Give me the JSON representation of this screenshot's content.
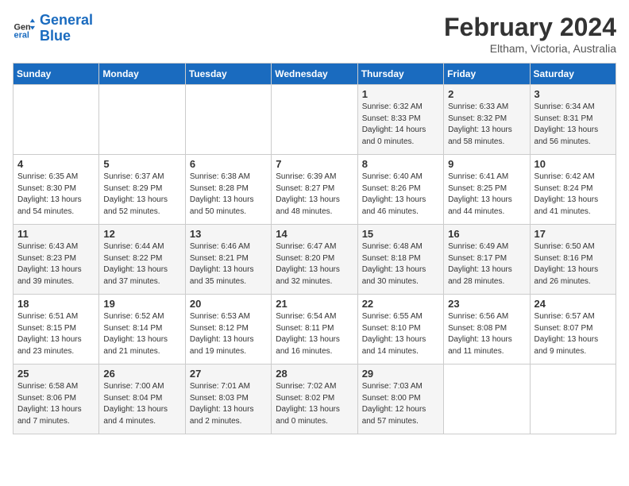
{
  "logo": {
    "line1": "General",
    "line2": "Blue"
  },
  "title": "February 2024",
  "location": "Eltham, Victoria, Australia",
  "headers": [
    "Sunday",
    "Monday",
    "Tuesday",
    "Wednesday",
    "Thursday",
    "Friday",
    "Saturday"
  ],
  "weeks": [
    [
      {
        "day": "",
        "sunrise": "",
        "sunset": "",
        "daylight": ""
      },
      {
        "day": "",
        "sunrise": "",
        "sunset": "",
        "daylight": ""
      },
      {
        "day": "",
        "sunrise": "",
        "sunset": "",
        "daylight": ""
      },
      {
        "day": "",
        "sunrise": "",
        "sunset": "",
        "daylight": ""
      },
      {
        "day": "1",
        "sunrise": "Sunrise: 6:32 AM",
        "sunset": "Sunset: 8:33 PM",
        "daylight": "Daylight: 14 hours and 0 minutes."
      },
      {
        "day": "2",
        "sunrise": "Sunrise: 6:33 AM",
        "sunset": "Sunset: 8:32 PM",
        "daylight": "Daylight: 13 hours and 58 minutes."
      },
      {
        "day": "3",
        "sunrise": "Sunrise: 6:34 AM",
        "sunset": "Sunset: 8:31 PM",
        "daylight": "Daylight: 13 hours and 56 minutes."
      }
    ],
    [
      {
        "day": "4",
        "sunrise": "Sunrise: 6:35 AM",
        "sunset": "Sunset: 8:30 PM",
        "daylight": "Daylight: 13 hours and 54 minutes."
      },
      {
        "day": "5",
        "sunrise": "Sunrise: 6:37 AM",
        "sunset": "Sunset: 8:29 PM",
        "daylight": "Daylight: 13 hours and 52 minutes."
      },
      {
        "day": "6",
        "sunrise": "Sunrise: 6:38 AM",
        "sunset": "Sunset: 8:28 PM",
        "daylight": "Daylight: 13 hours and 50 minutes."
      },
      {
        "day": "7",
        "sunrise": "Sunrise: 6:39 AM",
        "sunset": "Sunset: 8:27 PM",
        "daylight": "Daylight: 13 hours and 48 minutes."
      },
      {
        "day": "8",
        "sunrise": "Sunrise: 6:40 AM",
        "sunset": "Sunset: 8:26 PM",
        "daylight": "Daylight: 13 hours and 46 minutes."
      },
      {
        "day": "9",
        "sunrise": "Sunrise: 6:41 AM",
        "sunset": "Sunset: 8:25 PM",
        "daylight": "Daylight: 13 hours and 44 minutes."
      },
      {
        "day": "10",
        "sunrise": "Sunrise: 6:42 AM",
        "sunset": "Sunset: 8:24 PM",
        "daylight": "Daylight: 13 hours and 41 minutes."
      }
    ],
    [
      {
        "day": "11",
        "sunrise": "Sunrise: 6:43 AM",
        "sunset": "Sunset: 8:23 PM",
        "daylight": "Daylight: 13 hours and 39 minutes."
      },
      {
        "day": "12",
        "sunrise": "Sunrise: 6:44 AM",
        "sunset": "Sunset: 8:22 PM",
        "daylight": "Daylight: 13 hours and 37 minutes."
      },
      {
        "day": "13",
        "sunrise": "Sunrise: 6:46 AM",
        "sunset": "Sunset: 8:21 PM",
        "daylight": "Daylight: 13 hours and 35 minutes."
      },
      {
        "day": "14",
        "sunrise": "Sunrise: 6:47 AM",
        "sunset": "Sunset: 8:20 PM",
        "daylight": "Daylight: 13 hours and 32 minutes."
      },
      {
        "day": "15",
        "sunrise": "Sunrise: 6:48 AM",
        "sunset": "Sunset: 8:18 PM",
        "daylight": "Daylight: 13 hours and 30 minutes."
      },
      {
        "day": "16",
        "sunrise": "Sunrise: 6:49 AM",
        "sunset": "Sunset: 8:17 PM",
        "daylight": "Daylight: 13 hours and 28 minutes."
      },
      {
        "day": "17",
        "sunrise": "Sunrise: 6:50 AM",
        "sunset": "Sunset: 8:16 PM",
        "daylight": "Daylight: 13 hours and 26 minutes."
      }
    ],
    [
      {
        "day": "18",
        "sunrise": "Sunrise: 6:51 AM",
        "sunset": "Sunset: 8:15 PM",
        "daylight": "Daylight: 13 hours and 23 minutes."
      },
      {
        "day": "19",
        "sunrise": "Sunrise: 6:52 AM",
        "sunset": "Sunset: 8:14 PM",
        "daylight": "Daylight: 13 hours and 21 minutes."
      },
      {
        "day": "20",
        "sunrise": "Sunrise: 6:53 AM",
        "sunset": "Sunset: 8:12 PM",
        "daylight": "Daylight: 13 hours and 19 minutes."
      },
      {
        "day": "21",
        "sunrise": "Sunrise: 6:54 AM",
        "sunset": "Sunset: 8:11 PM",
        "daylight": "Daylight: 13 hours and 16 minutes."
      },
      {
        "day": "22",
        "sunrise": "Sunrise: 6:55 AM",
        "sunset": "Sunset: 8:10 PM",
        "daylight": "Daylight: 13 hours and 14 minutes."
      },
      {
        "day": "23",
        "sunrise": "Sunrise: 6:56 AM",
        "sunset": "Sunset: 8:08 PM",
        "daylight": "Daylight: 13 hours and 11 minutes."
      },
      {
        "day": "24",
        "sunrise": "Sunrise: 6:57 AM",
        "sunset": "Sunset: 8:07 PM",
        "daylight": "Daylight: 13 hours and 9 minutes."
      }
    ],
    [
      {
        "day": "25",
        "sunrise": "Sunrise: 6:58 AM",
        "sunset": "Sunset: 8:06 PM",
        "daylight": "Daylight: 13 hours and 7 minutes."
      },
      {
        "day": "26",
        "sunrise": "Sunrise: 7:00 AM",
        "sunset": "Sunset: 8:04 PM",
        "daylight": "Daylight: 13 hours and 4 minutes."
      },
      {
        "day": "27",
        "sunrise": "Sunrise: 7:01 AM",
        "sunset": "Sunset: 8:03 PM",
        "daylight": "Daylight: 13 hours and 2 minutes."
      },
      {
        "day": "28",
        "sunrise": "Sunrise: 7:02 AM",
        "sunset": "Sunset: 8:02 PM",
        "daylight": "Daylight: 13 hours and 0 minutes."
      },
      {
        "day": "29",
        "sunrise": "Sunrise: 7:03 AM",
        "sunset": "Sunset: 8:00 PM",
        "daylight": "Daylight: 12 hours and 57 minutes."
      },
      {
        "day": "",
        "sunrise": "",
        "sunset": "",
        "daylight": ""
      },
      {
        "day": "",
        "sunrise": "",
        "sunset": "",
        "daylight": ""
      }
    ]
  ]
}
